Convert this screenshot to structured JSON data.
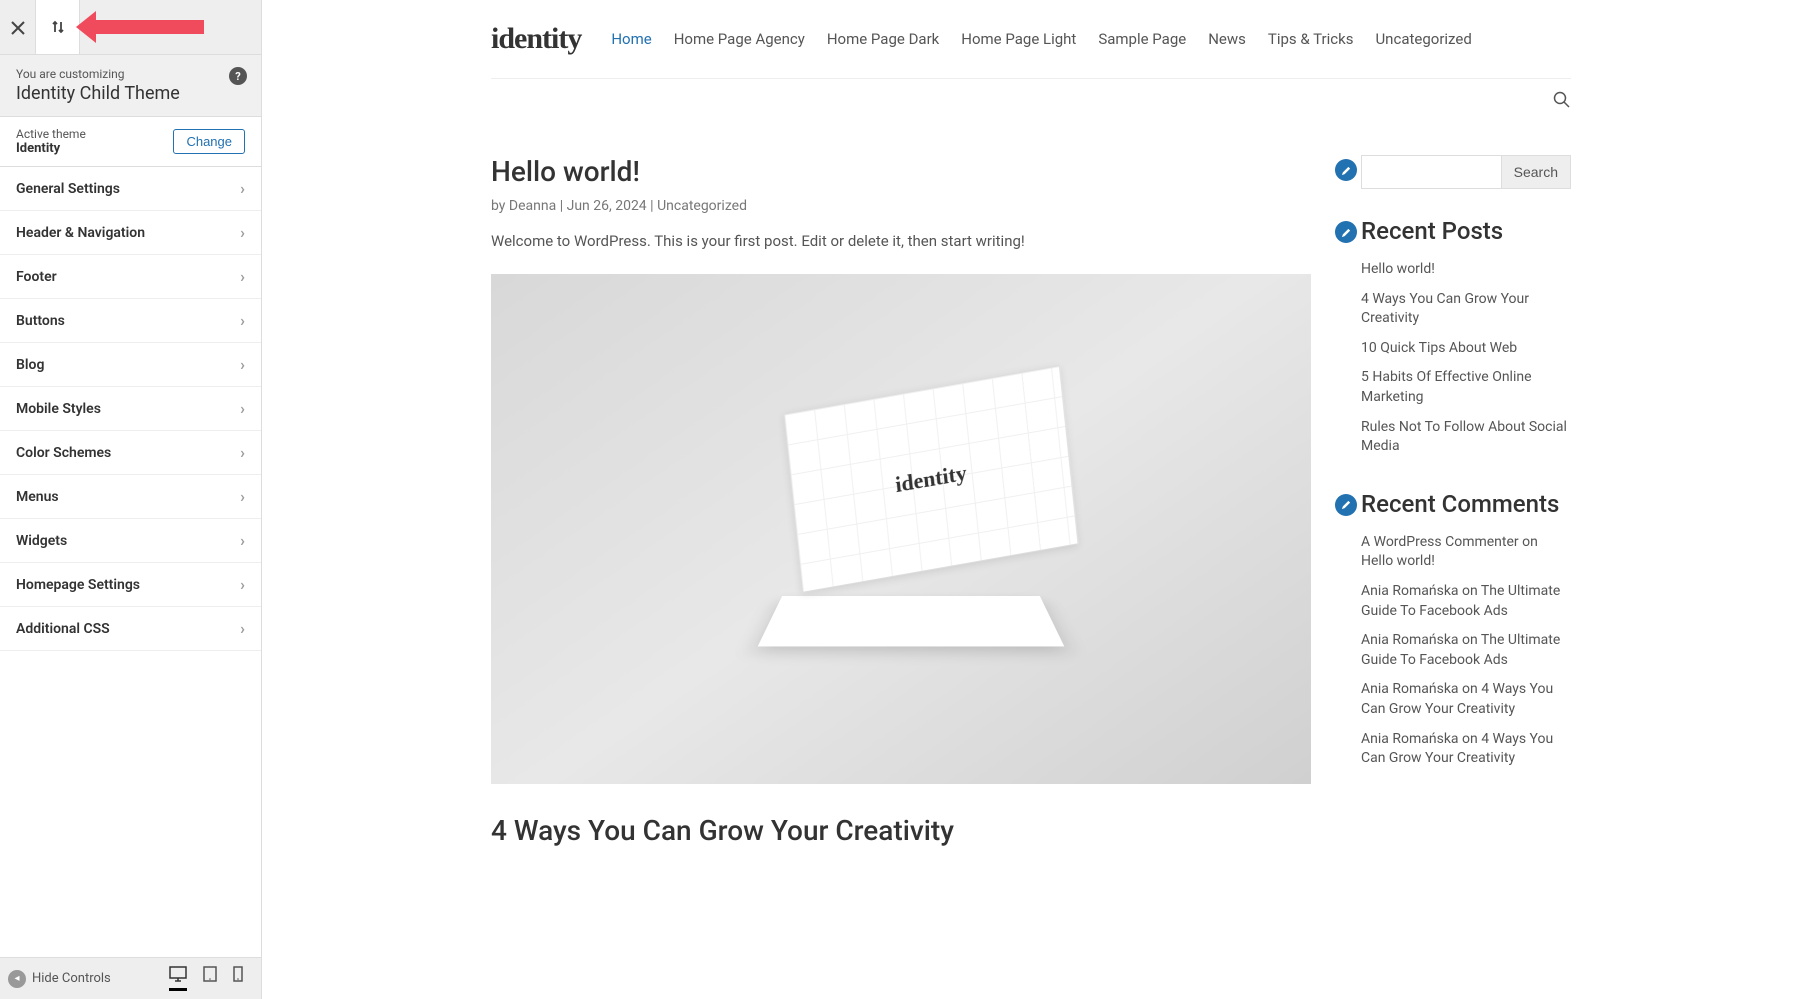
{
  "customizer": {
    "customizing_label": "You are customizing",
    "theme_name": "Identity Child Theme",
    "active_theme_label": "Active theme",
    "active_theme_name": "Identity",
    "change_button": "Change",
    "hide_controls": "Hide Controls",
    "panels": [
      "General Settings",
      "Header & Navigation",
      "Footer",
      "Buttons",
      "Blog",
      "Mobile Styles",
      "Color Schemes",
      "Menus",
      "Widgets",
      "Homepage Settings",
      "Additional CSS"
    ]
  },
  "site": {
    "logo": "identity",
    "nav": [
      "Home",
      "Home Page Agency",
      "Home Page Dark",
      "Home Page Light",
      "Sample Page",
      "News",
      "Tips & Tricks",
      "Uncategorized"
    ],
    "post": {
      "title": "Hello world!",
      "meta_by": "by",
      "author": "Deanna",
      "sep": " | ",
      "date": "Jun 26, 2024",
      "category": "Uncategorized",
      "excerpt": "Welcome to WordPress. This is your first post. Edit or delete it, then start writing!",
      "image_logo": "identity"
    },
    "post2_title": "4 Ways You Can Grow Your Creativity",
    "search_button": "Search",
    "recent_posts_title": "Recent Posts",
    "recent_posts": [
      "Hello world!",
      "4 Ways You Can Grow Your Creativity",
      "10 Quick Tips About Web",
      "5 Habits Of Effective Online Marketing",
      "Rules Not To Follow About Social Media"
    ],
    "recent_comments_title": "Recent Comments",
    "recent_comments": [
      "A WordPress Commenter on Hello world!",
      "Ania Romańska on The Ultimate Guide To Facebook Ads",
      "Ania Romańska on The Ultimate Guide To Facebook Ads",
      "Ania Romańska on 4 Ways You Can Grow Your Creativity",
      "Ania Romańska on 4 Ways You Can Grow Your Creativity"
    ]
  }
}
